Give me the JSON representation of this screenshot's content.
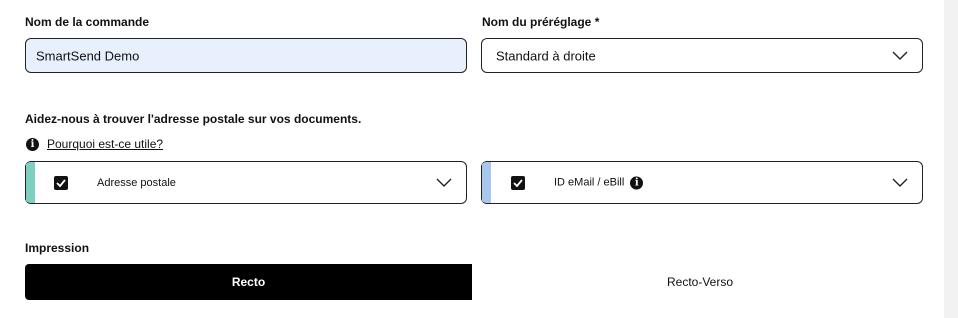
{
  "order": {
    "label": "Nom de la commande",
    "value": "SmartSend Demo"
  },
  "preset": {
    "label": "Nom du préréglage *",
    "value": "Standard à droite"
  },
  "address_help": {
    "heading": "Aidez-nous à trouver l'adresse postale sur vos documents.",
    "why_link": "Pourquoi est-ce utile?"
  },
  "postal": {
    "label": "Adresse postale",
    "checked": true,
    "accent": "#7ecfc0"
  },
  "ebill": {
    "label": "ID eMail / eBill",
    "checked": true,
    "accent": "#a9c7ea"
  },
  "print": {
    "label": "Impression",
    "options": [
      "Recto",
      "Recto-Verso"
    ],
    "selected": "Recto"
  },
  "colors": {
    "selected_bg": "#000000",
    "input_bg": "#e8f0fe",
    "sidebar_bg": "#f2f2f2"
  }
}
